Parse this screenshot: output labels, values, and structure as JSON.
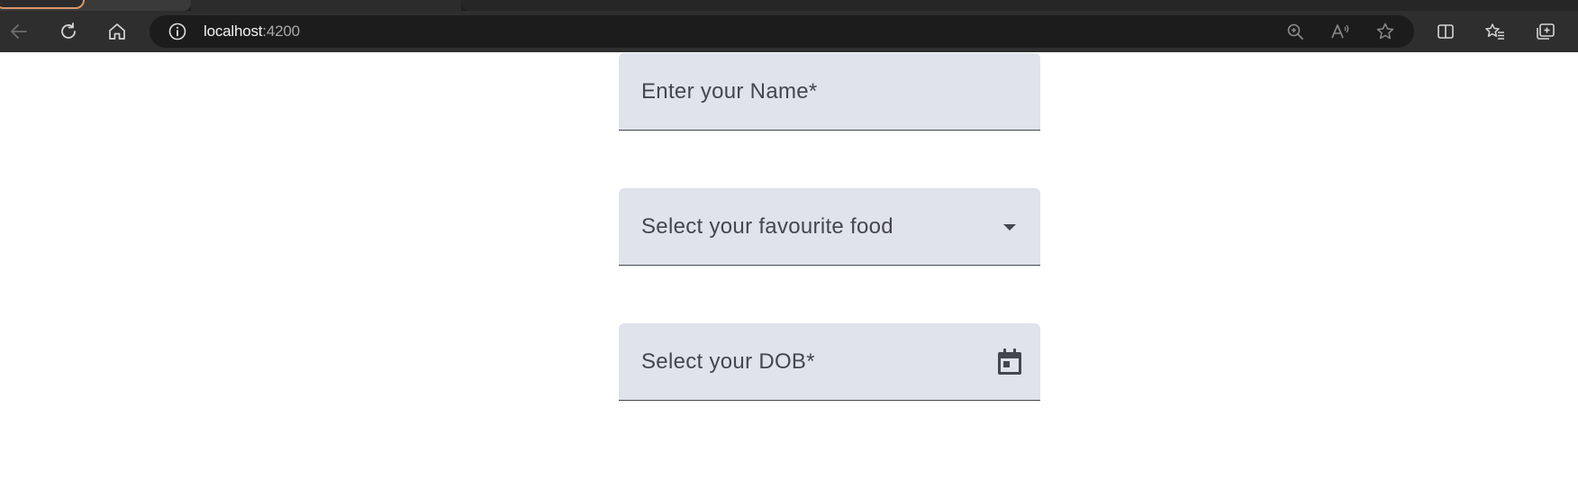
{
  "browser": {
    "address": {
      "host": "localhost",
      "port": ":4200"
    },
    "toolbar_icons": [
      "back-icon",
      "refresh-icon",
      "home-icon",
      "info-icon",
      "zoom-icon",
      "read-aloud-icon",
      "favorite-star-icon",
      "split-screen-icon",
      "favorites-icon",
      "collections-icon"
    ]
  },
  "form": {
    "name_field": {
      "label": "Enter your Name*"
    },
    "food_field": {
      "label": "Select your favourite food"
    },
    "dob_field": {
      "label": "Select your DOB*"
    }
  },
  "colors": {
    "field_background": "#e0e2ec",
    "field_text": "#44474e",
    "field_underline": "#44474f",
    "chrome_toolbar": "#2e2e2e",
    "address_bar": "#1c1c1c"
  }
}
